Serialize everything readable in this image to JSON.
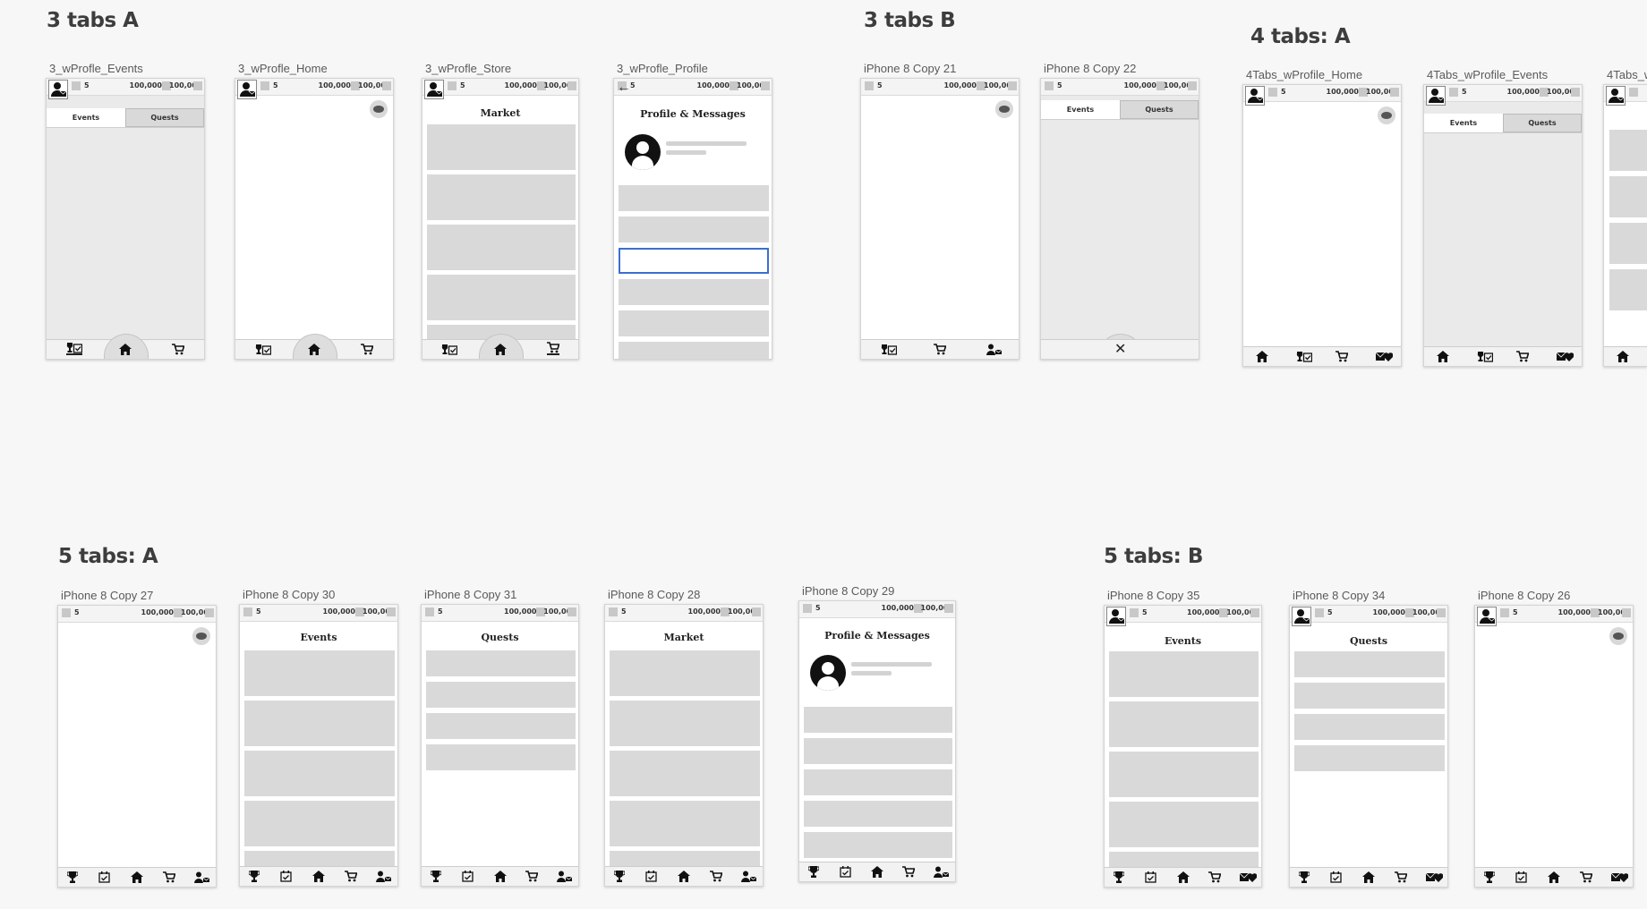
{
  "sections": {
    "tabs3a": "3 tabs A",
    "tabs3b": "3 tabs B",
    "tabs4a": "4 tabs: A",
    "tabs5a": "5 tabs: A",
    "tabs5b": "5 tabs: B"
  },
  "status": {
    "currency": "5",
    "value1": "100,000",
    "value2": "100,000"
  },
  "tab_labels": {
    "events": "Events",
    "quests": "Quests"
  },
  "screen_titles": {
    "market": "Market",
    "profile": "Profile & Messages",
    "events": "Events",
    "quests": "Quests"
  },
  "frames": {
    "f1": "3_wProfle_Events",
    "f2": "3_wProfle_Home",
    "f3": "3_wProfle_Store",
    "f4": "3_wProfle_Profile",
    "f5": "iPhone 8 Copy 21",
    "f6": "iPhone 8 Copy 22",
    "f7": "4Tabs_wProfile_Home",
    "f8": "4Tabs_wProfile_Events",
    "f9": "4Tabs_w",
    "f10": "iPhone 8 Copy 27",
    "f11": "iPhone 8 Copy 30",
    "f12": "iPhone 8 Copy 31",
    "f13": "iPhone 8 Copy 28",
    "f14": "iPhone 8 Copy 29",
    "f15": "iPhone 8 Copy 35",
    "f16": "iPhone 8 Copy 34",
    "f17": "iPhone 8 Copy 26"
  },
  "icons": {
    "home": "home-icon",
    "cart": "cart-icon",
    "events": "events-icon",
    "trophy": "trophy-icon",
    "calendar": "calendar-icon",
    "profile": "profile-msg-icon",
    "heart_msg": "heart-mail-icon",
    "chat": "chat-bubble-icon",
    "back": "back-arrow-icon",
    "close": "close-icon"
  },
  "colors": {
    "background": "#f7f7f7",
    "card": "#d9d9d9",
    "selected": "#3b6fcf"
  }
}
